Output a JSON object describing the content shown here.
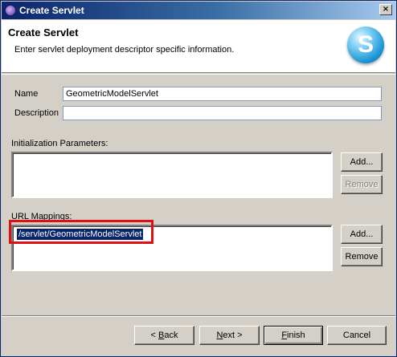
{
  "window": {
    "title": "Create Servlet",
    "close_glyph": "×"
  },
  "header": {
    "title": "Create Servlet",
    "description": "Enter servlet deployment descriptor specific information.",
    "logo_letter": "S"
  },
  "form": {
    "name_label": "Name",
    "name_value": "GeometricModelServlet",
    "description_label": "Description",
    "description_value": ""
  },
  "init_params": {
    "label": "Initialization Parameters:",
    "items": [],
    "add_label": "Add...",
    "remove_label": "Remove"
  },
  "url_mappings": {
    "label": "URL Mappings:",
    "items": [
      "/servlet/GeometricModelServlet"
    ],
    "add_label": "Add...",
    "remove_label": "Remove"
  },
  "footer": {
    "back_prefix": "< ",
    "back_mnemonic": "B",
    "back_rest": "ack",
    "next_mnemonic": "N",
    "next_rest": "ext >",
    "finish_mnemonic": "F",
    "finish_rest": "inish",
    "cancel_label": "Cancel"
  },
  "colors": {
    "title_bar": "#0a246a",
    "selection": "#0a246a",
    "highlight_annotation": "#e01010"
  }
}
